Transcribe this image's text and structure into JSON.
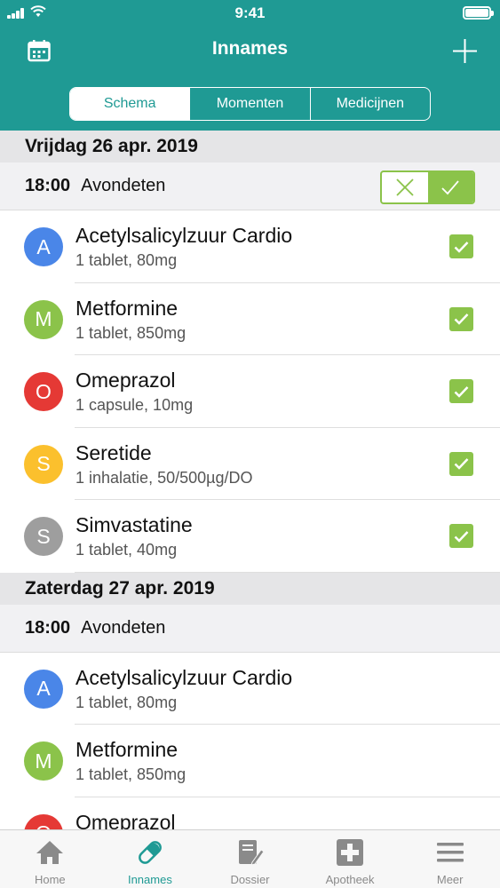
{
  "status_bar": {
    "time": "9:41"
  },
  "header": {
    "title": "Innames",
    "segments": [
      {
        "label": "Schema",
        "active": true
      },
      {
        "label": "Momenten",
        "active": false
      },
      {
        "label": "Medicijnen",
        "active": false
      }
    ]
  },
  "colors": {
    "primary": "#1f9a94",
    "check_green": "#8bc34a"
  },
  "days": [
    {
      "date": "Vrijdag 26 apr. 2019",
      "moment_time": "18:00",
      "moment_label": "Avondeten",
      "toggle_shown": true,
      "meds": [
        {
          "initial": "A",
          "color": "#4a86e8",
          "name": "Acetylsalicylzuur Cardio",
          "dose": "1 tablet, 80mg",
          "checked": true
        },
        {
          "initial": "M",
          "color": "#8bc34a",
          "name": "Metformine",
          "dose": "1 tablet, 850mg",
          "checked": true
        },
        {
          "initial": "O",
          "color": "#e53935",
          "name": "Omeprazol",
          "dose": "1 capsule, 10mg",
          "checked": true
        },
        {
          "initial": "S",
          "color": "#fbc02d",
          "name": "Seretide",
          "dose": "1 inhalatie, 50/500µg/DO",
          "checked": true
        },
        {
          "initial": "S",
          "color": "#9e9e9e",
          "name": "Simvastatine",
          "dose": "1 tablet, 40mg",
          "checked": true
        }
      ]
    },
    {
      "date": "Zaterdag 27 apr. 2019",
      "moment_time": "18:00",
      "moment_label": "Avondeten",
      "toggle_shown": false,
      "meds": [
        {
          "initial": "A",
          "color": "#4a86e8",
          "name": "Acetylsalicylzuur Cardio",
          "dose": "1 tablet, 80mg",
          "checked": false
        },
        {
          "initial": "M",
          "color": "#8bc34a",
          "name": "Metformine",
          "dose": "1 tablet, 850mg",
          "checked": false
        },
        {
          "initial": "O",
          "color": "#e53935",
          "name": "Omeprazol",
          "dose": "",
          "checked": false
        }
      ]
    }
  ],
  "tabbar": {
    "items": [
      {
        "label": "Home",
        "icon": "home-icon",
        "active": false
      },
      {
        "label": "Innames",
        "icon": "pill-icon",
        "active": true
      },
      {
        "label": "Dossier",
        "icon": "dossier-icon",
        "active": false
      },
      {
        "label": "Apotheek",
        "icon": "pharmacy-cross-icon",
        "active": false
      },
      {
        "label": "Meer",
        "icon": "menu-icon",
        "active": false
      }
    ]
  }
}
